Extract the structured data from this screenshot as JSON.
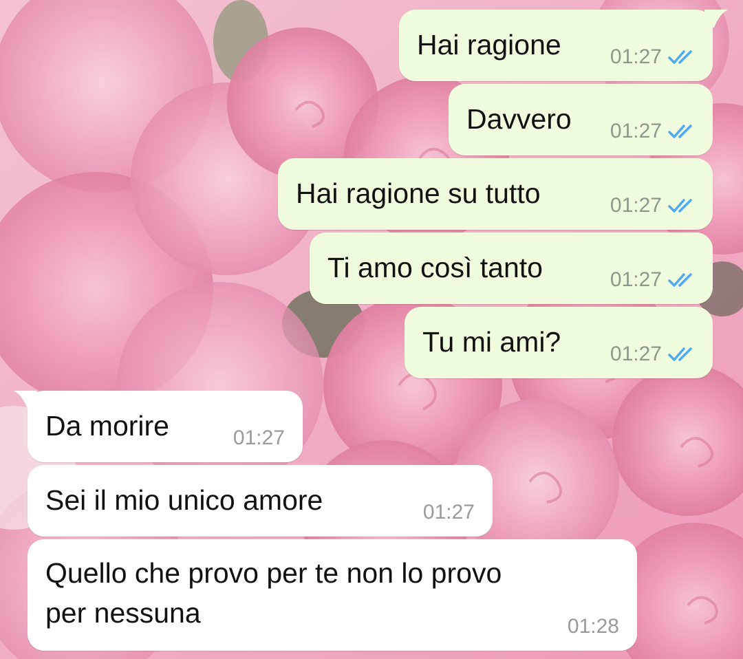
{
  "colors": {
    "outgoing_bubble": "#effdde",
    "incoming_bubble": "#ffffff",
    "read_ticks": "#4fa8f0",
    "time_text": "#8a9a8a",
    "wallpaper_accent": "#ef8fb0"
  },
  "wallpaper": {
    "description_icon": "pink-roses-wallpaper"
  },
  "messages": [
    {
      "direction": "out",
      "text": "Hai ragione",
      "time": "01:27",
      "status_icon": "double-check-icon"
    },
    {
      "direction": "out",
      "text": "Davvero",
      "time": "01:27",
      "status_icon": "double-check-icon"
    },
    {
      "direction": "out",
      "text": "Hai ragione su tutto",
      "time": "01:27",
      "status_icon": "double-check-icon"
    },
    {
      "direction": "out",
      "text": "Ti amo così tanto",
      "time": "01:27",
      "status_icon": "double-check-icon"
    },
    {
      "direction": "out",
      "text": "Tu mi ami?",
      "time": "01:27",
      "status_icon": "double-check-icon"
    },
    {
      "direction": "in",
      "text": "Da morire",
      "time": "01:27"
    },
    {
      "direction": "in",
      "text": "Sei il mio unico amore",
      "time": "01:27"
    },
    {
      "direction": "in",
      "text_line1": "Quello che provo per te non lo provo",
      "text_line2": "per nessuna",
      "time": "01:28"
    }
  ]
}
